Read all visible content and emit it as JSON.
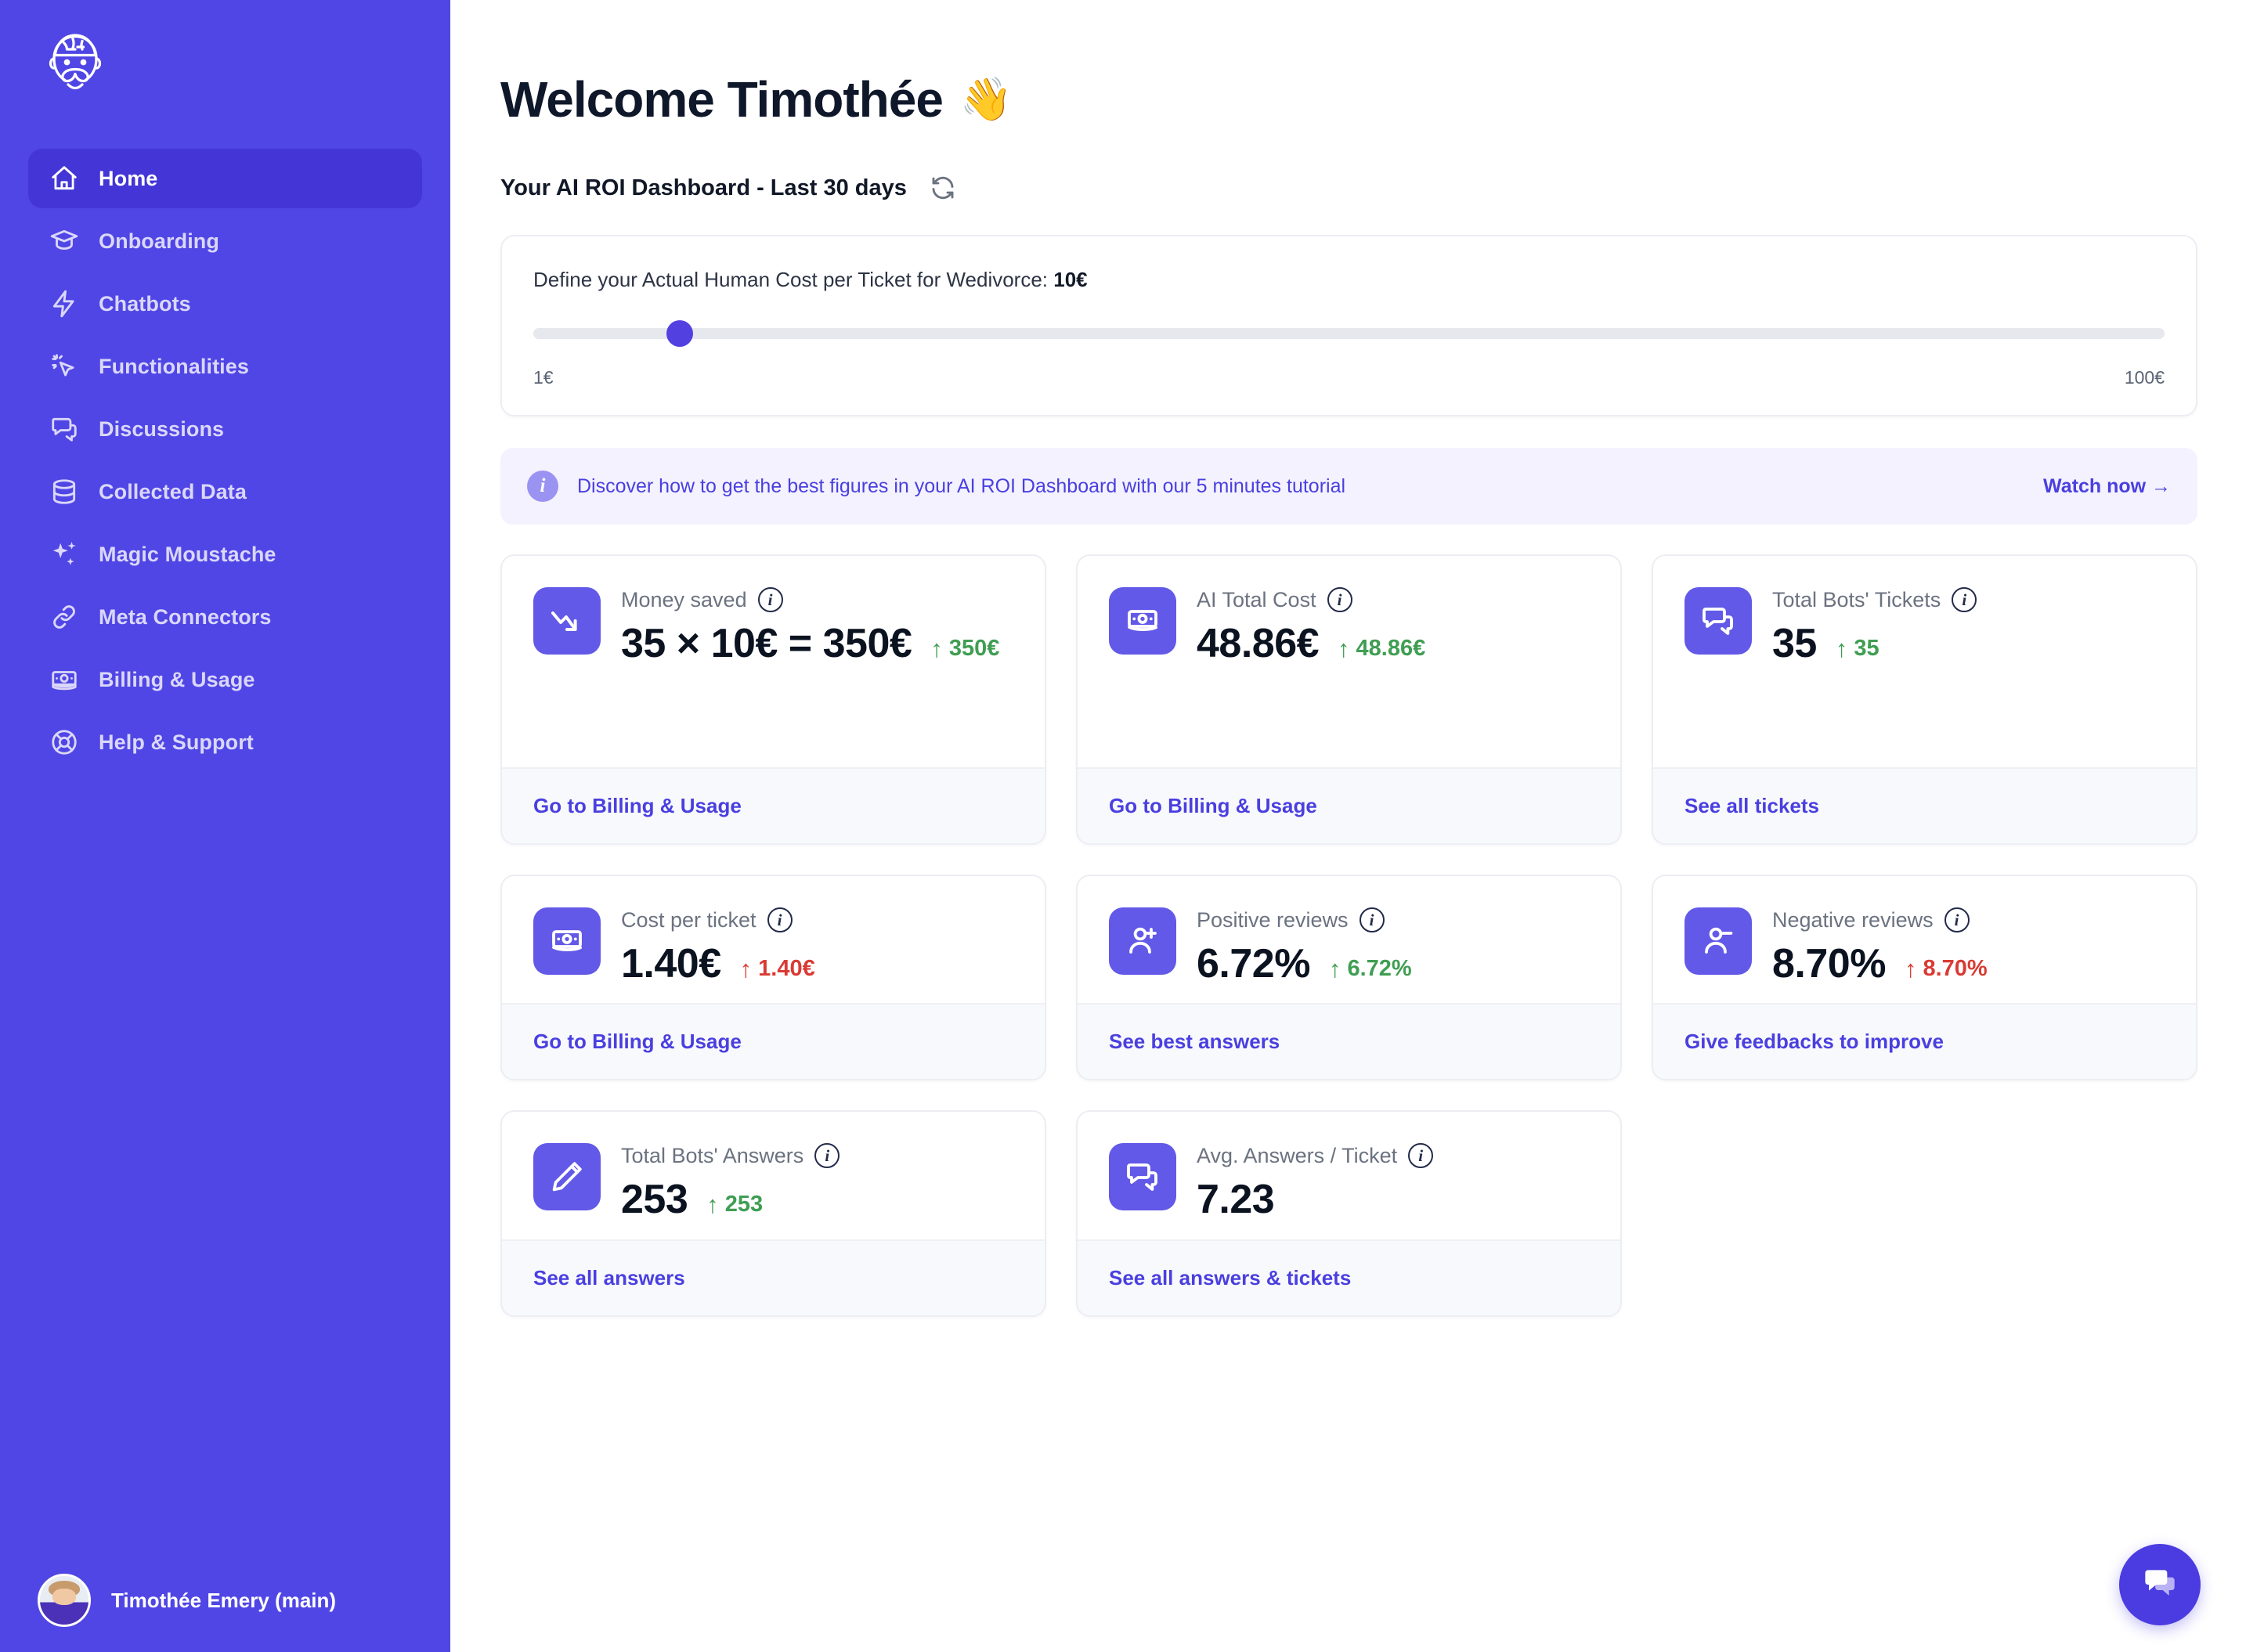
{
  "sidebar": {
    "logo_icon": "moustache-brain-logo",
    "items": [
      {
        "label": "Home",
        "icon": "home-icon",
        "active": true
      },
      {
        "label": "Onboarding",
        "icon": "graduation-cap-icon",
        "active": false
      },
      {
        "label": "Chatbots",
        "icon": "lightning-bolt-icon",
        "active": false
      },
      {
        "label": "Functionalities",
        "icon": "cursor-click-icon",
        "active": false
      },
      {
        "label": "Discussions",
        "icon": "chat-bubbles-icon",
        "active": false
      },
      {
        "label": "Collected Data",
        "icon": "database-icon",
        "active": false
      },
      {
        "label": "Magic Moustache",
        "icon": "sparkles-icon",
        "active": false
      },
      {
        "label": "Meta Connectors",
        "icon": "link-chain-icon",
        "active": false
      },
      {
        "label": "Billing & Usage",
        "icon": "banknote-icon",
        "active": false
      },
      {
        "label": "Help & Support",
        "icon": "lifebuoy-icon",
        "active": false
      }
    ],
    "user": {
      "name": "Timothée Emery (main)",
      "avatar": "user-avatar"
    }
  },
  "header": {
    "title": "Welcome Timothée",
    "wave_emoji": "👋",
    "subtitle": "Your AI ROI Dashboard - Last 30 days",
    "refresh_icon": "refresh-icon"
  },
  "slider": {
    "label_prefix": "Define your Actual Human Cost per Ticket for Wedivorce: ",
    "value_label": "10€",
    "min_label": "1€",
    "max_label": "100€",
    "min": 1,
    "max": 100,
    "value": 10,
    "percent": 9
  },
  "banner": {
    "info_icon": "info-icon",
    "text": "Discover how to get the best figures in your AI ROI Dashboard with our 5 minutes tutorial",
    "cta": "Watch now →"
  },
  "cards": [
    {
      "title": "Money saved",
      "icon": "trend-down-arrow-icon",
      "value": "35 × 10€ = 350€",
      "delta": "350€",
      "delta_arrow": "↑",
      "delta_dir": "up",
      "link": "Go to Billing & Usage",
      "info_icon": "info-icon"
    },
    {
      "title": "AI Total Cost",
      "icon": "banknote-icon",
      "value": "48.86€",
      "delta": "48.86€",
      "delta_arrow": "↑",
      "delta_dir": "up",
      "link": "Go to Billing & Usage",
      "info_icon": "info-icon"
    },
    {
      "title": "Total Bots' Tickets",
      "icon": "chat-bubbles-icon",
      "value": "35",
      "delta": "35",
      "delta_arrow": "↑",
      "delta_dir": "up",
      "link": "See all tickets",
      "info_icon": "info-icon"
    },
    {
      "title": "Cost per ticket",
      "icon": "banknote-icon",
      "value": "1.40€",
      "delta": "1.40€",
      "delta_arrow": "↑",
      "delta_dir": "down",
      "link": "Go to Billing & Usage",
      "info_icon": "info-icon"
    },
    {
      "title": "Positive reviews",
      "icon": "user-plus-icon",
      "value": "6.72%",
      "delta": "6.72%",
      "delta_arrow": "↑",
      "delta_dir": "up",
      "link": "See best answers",
      "info_icon": "info-icon"
    },
    {
      "title": "Negative reviews",
      "icon": "user-minus-icon",
      "value": "8.70%",
      "delta": "8.70%",
      "delta_arrow": "↑",
      "delta_dir": "down",
      "link": "Give feedbacks to improve",
      "info_icon": "info-icon"
    },
    {
      "title": "Total Bots' Answers",
      "icon": "pencil-icon",
      "value": "253",
      "delta": "253",
      "delta_arrow": "↑",
      "delta_dir": "up",
      "link": "See all answers",
      "info_icon": "info-icon"
    },
    {
      "title": "Avg. Answers / Ticket",
      "icon": "chat-bubbles-icon",
      "value": "7.23",
      "delta": "",
      "delta_arrow": "",
      "delta_dir": "",
      "link": "See all answers & tickets",
      "info_icon": "info-icon"
    }
  ],
  "chat_fab": {
    "icon": "chat-bubbles-icon"
  },
  "colors": {
    "brand": "#5046E5",
    "brand_active": "#4335D6",
    "card_icon": "#6259E8",
    "link": "#4a3fe0",
    "up": "#3f9e52",
    "down": "#d93b34",
    "banner_bg": "#f3f2fe"
  }
}
